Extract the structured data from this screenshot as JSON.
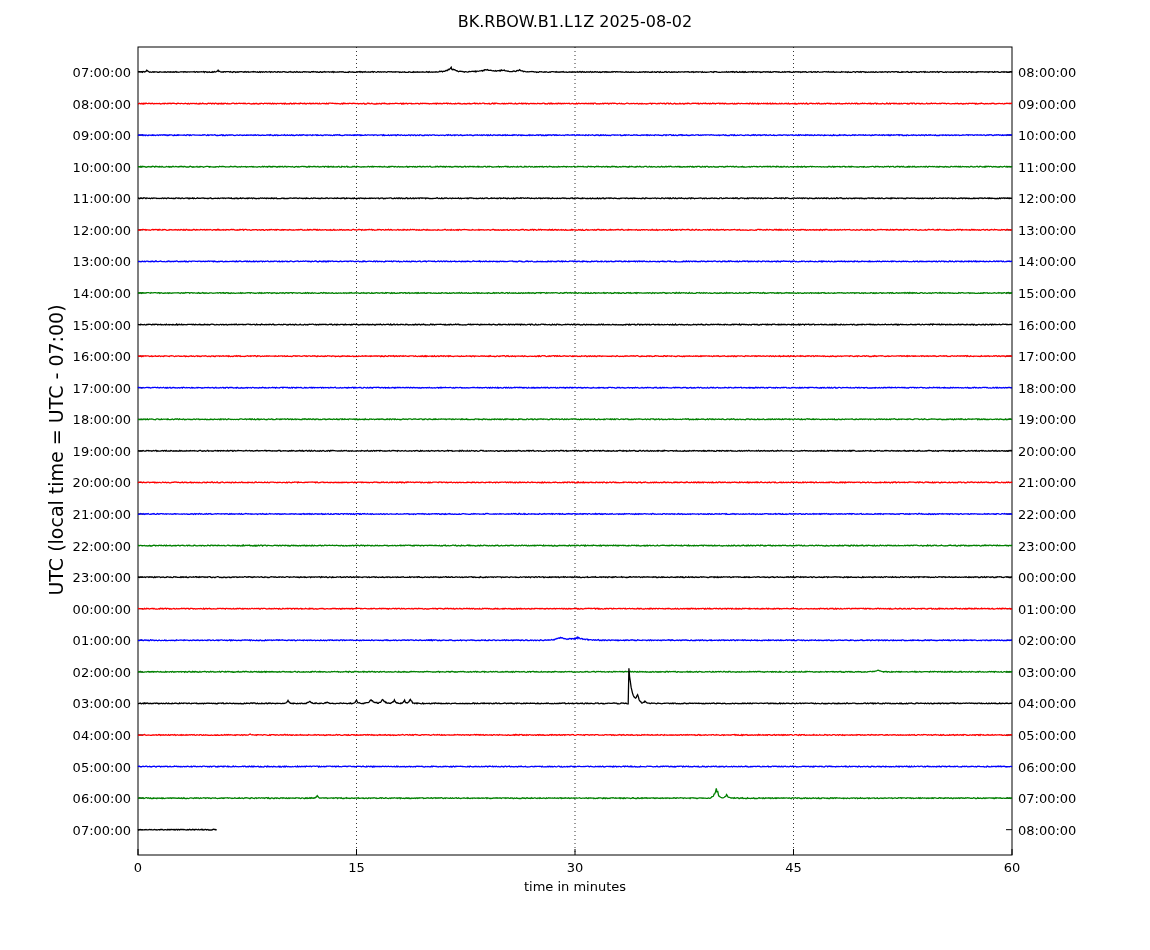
{
  "title": "BK.RBOW.B1.L1Z 2025-08-02",
  "ylabel": "UTC (local time = UTC - 07:00)",
  "xlabel": "time in minutes",
  "xticks": [
    "0",
    "15",
    "30",
    "45",
    "60"
  ],
  "traces": [
    {
      "left": "07:00:00",
      "right": "08:00:00",
      "color": "#000000",
      "kind": "full"
    },
    {
      "left": "08:00:00",
      "right": "09:00:00",
      "color": "#ff0000",
      "kind": "full"
    },
    {
      "left": "09:00:00",
      "right": "10:00:00",
      "color": "#0000ff",
      "kind": "full"
    },
    {
      "left": "10:00:00",
      "right": "11:00:00",
      "color": "#008000",
      "kind": "full"
    },
    {
      "left": "11:00:00",
      "right": "12:00:00",
      "color": "#000000",
      "kind": "full"
    },
    {
      "left": "12:00:00",
      "right": "13:00:00",
      "color": "#ff0000",
      "kind": "full"
    },
    {
      "left": "13:00:00",
      "right": "14:00:00",
      "color": "#0000ff",
      "kind": "full"
    },
    {
      "left": "14:00:00",
      "right": "15:00:00",
      "color": "#008000",
      "kind": "full"
    },
    {
      "left": "15:00:00",
      "right": "16:00:00",
      "color": "#000000",
      "kind": "full"
    },
    {
      "left": "16:00:00",
      "right": "17:00:00",
      "color": "#ff0000",
      "kind": "full"
    },
    {
      "left": "17:00:00",
      "right": "18:00:00",
      "color": "#0000ff",
      "kind": "full"
    },
    {
      "left": "18:00:00",
      "right": "19:00:00",
      "color": "#008000",
      "kind": "full"
    },
    {
      "left": "19:00:00",
      "right": "20:00:00",
      "color": "#000000",
      "kind": "full"
    },
    {
      "left": "20:00:00",
      "right": "21:00:00",
      "color": "#ff0000",
      "kind": "full"
    },
    {
      "left": "21:00:00",
      "right": "22:00:00",
      "color": "#0000ff",
      "kind": "full"
    },
    {
      "left": "22:00:00",
      "right": "23:00:00",
      "color": "#008000",
      "kind": "full"
    },
    {
      "left": "23:00:00",
      "right": "00:00:00",
      "color": "#000000",
      "kind": "full"
    },
    {
      "left": "00:00:00",
      "right": "01:00:00",
      "color": "#ff0000",
      "kind": "full"
    },
    {
      "left": "01:00:00",
      "right": "02:00:00",
      "color": "#0000ff",
      "kind": "full"
    },
    {
      "left": "02:00:00",
      "right": "03:00:00",
      "color": "#008000",
      "kind": "full"
    },
    {
      "left": "03:00:00",
      "right": "04:00:00",
      "color": "#000000",
      "kind": "full"
    },
    {
      "left": "04:00:00",
      "right": "05:00:00",
      "color": "#ff0000",
      "kind": "full"
    },
    {
      "left": "05:00:00",
      "right": "06:00:00",
      "color": "#0000ff",
      "kind": "full"
    },
    {
      "left": "06:00:00",
      "right": "07:00:00",
      "color": "#008000",
      "kind": "full"
    },
    {
      "left": "07:00:00",
      "right": "08:00:00",
      "color": "#000000",
      "kind": "partial"
    }
  ]
}
